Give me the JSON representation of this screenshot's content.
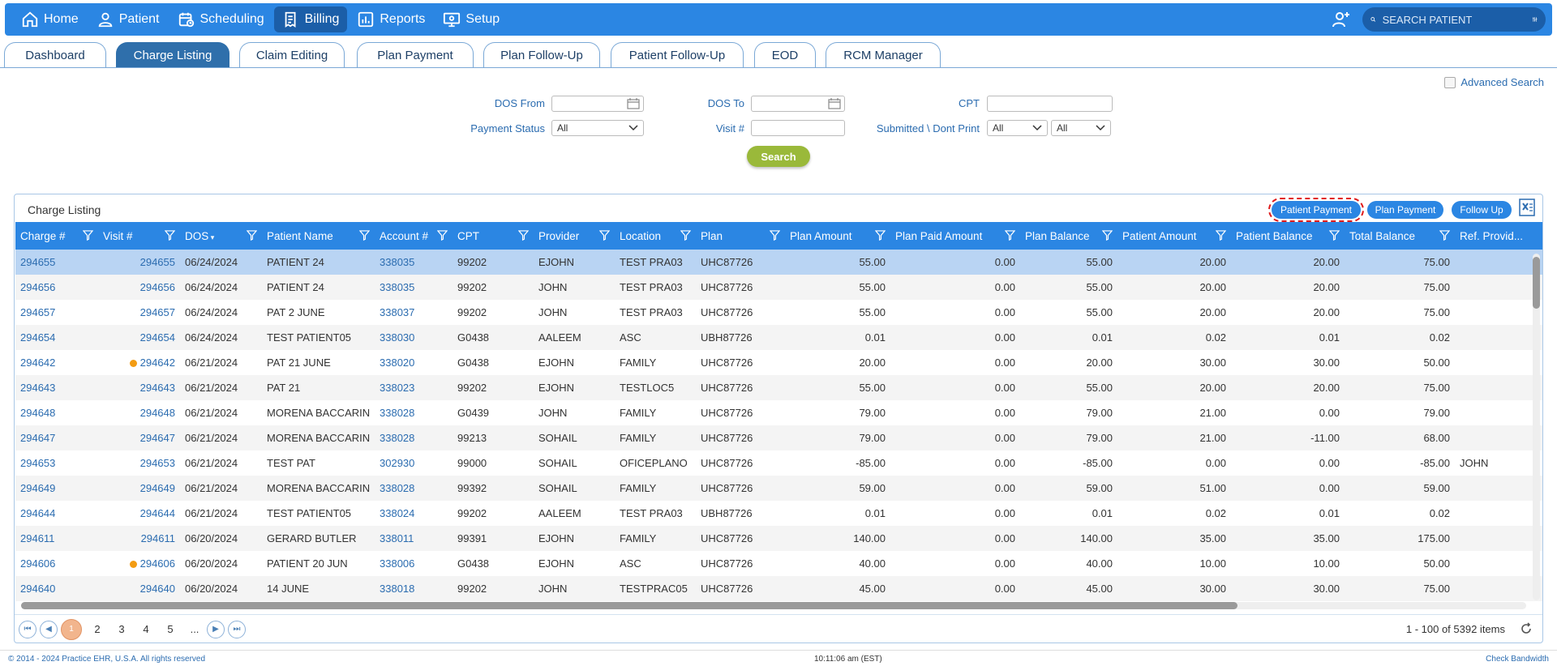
{
  "nav": {
    "items": [
      {
        "label": "Home",
        "icon": "home-icon"
      },
      {
        "label": "Patient",
        "icon": "user-icon"
      },
      {
        "label": "Scheduling",
        "icon": "calendar-clock-icon"
      },
      {
        "label": "Billing",
        "icon": "invoice-icon"
      },
      {
        "label": "Reports",
        "icon": "bar-chart-icon"
      },
      {
        "label": "Setup",
        "icon": "monitor-gear-icon"
      }
    ],
    "search_placeholder": "SEARCH PATIENT"
  },
  "tabs": [
    "Dashboard",
    "Charge Listing",
    "Claim Editing",
    "Plan Payment",
    "Plan Follow-Up",
    "Patient Follow-Up",
    "EOD",
    "RCM Manager"
  ],
  "filters": {
    "advanced_search": "Advanced Search",
    "dos_from": "DOS From",
    "dos_to": "DOS To",
    "cpt": "CPT",
    "payment_status": "Payment Status",
    "payment_status_value": "All",
    "visit": "Visit #",
    "submitted": "Submitted \\ Dont Print",
    "submitted_value1": "All",
    "submitted_value2": "All",
    "search_button": "Search"
  },
  "panel": {
    "title": "Charge Listing",
    "buttons": {
      "patient_payment": "Patient Payment",
      "plan_payment": "Plan Payment",
      "follow_up": "Follow Up"
    }
  },
  "columns": [
    "Charge #",
    "Visit #",
    "DOS",
    "Patient Name",
    "Account #",
    "CPT",
    "Provider",
    "Location",
    "Plan",
    "Plan Amount",
    "Plan Paid Amount",
    "Plan Balance",
    "Patient Amount",
    "Patient Balance",
    "Total Balance",
    "Ref. Provid..."
  ],
  "rows": [
    {
      "charge": "294655",
      "visit": "294655",
      "dot": false,
      "dos": "06/24/2024",
      "patient": "PATIENT 24",
      "account": "338035",
      "cpt": "99202",
      "provider": "EJOHN",
      "location": "TEST PRA03",
      "plan": "UHC87726",
      "plan_amount": "55.00",
      "plan_paid": "0.00",
      "plan_balance": "55.00",
      "patient_amount": "20.00",
      "patient_balance": "20.00",
      "total_balance": "75.00",
      "ref": ""
    },
    {
      "charge": "294656",
      "visit": "294656",
      "dot": false,
      "dos": "06/24/2024",
      "patient": "PATIENT 24",
      "account": "338035",
      "cpt": "99202",
      "provider": "JOHN",
      "location": "TEST PRA03",
      "plan": "UHC87726",
      "plan_amount": "55.00",
      "plan_paid": "0.00",
      "plan_balance": "55.00",
      "patient_amount": "20.00",
      "patient_balance": "20.00",
      "total_balance": "75.00",
      "ref": ""
    },
    {
      "charge": "294657",
      "visit": "294657",
      "dot": false,
      "dos": "06/24/2024",
      "patient": "PAT 2 JUNE",
      "account": "338037",
      "cpt": "99202",
      "provider": "JOHN",
      "location": "TEST PRA03",
      "plan": "UHC87726",
      "plan_amount": "55.00",
      "plan_paid": "0.00",
      "plan_balance": "55.00",
      "patient_amount": "20.00",
      "patient_balance": "20.00",
      "total_balance": "75.00",
      "ref": ""
    },
    {
      "charge": "294654",
      "visit": "294654",
      "dot": false,
      "dos": "06/24/2024",
      "patient": "TEST PATIENT05",
      "account": "338030",
      "cpt": "G0438",
      "provider": "AALEEM",
      "location": "ASC",
      "plan": "UBH87726",
      "plan_amount": "0.01",
      "plan_paid": "0.00",
      "plan_balance": "0.01",
      "patient_amount": "0.02",
      "patient_balance": "0.01",
      "total_balance": "0.02",
      "ref": ""
    },
    {
      "charge": "294642",
      "visit": "294642",
      "dot": true,
      "dos": "06/21/2024",
      "patient": "PAT 21 JUNE",
      "account": "338020",
      "cpt": "G0438",
      "provider": "EJOHN",
      "location": "FAMILY",
      "plan": "UHC87726",
      "plan_amount": "20.00",
      "plan_paid": "0.00",
      "plan_balance": "20.00",
      "patient_amount": "30.00",
      "patient_balance": "30.00",
      "total_balance": "50.00",
      "ref": ""
    },
    {
      "charge": "294643",
      "visit": "294643",
      "dot": false,
      "dos": "06/21/2024",
      "patient": "PAT 21",
      "account": "338023",
      "cpt": "99202",
      "provider": "EJOHN",
      "location": "TESTLOC5",
      "plan": "UHC87726",
      "plan_amount": "55.00",
      "plan_paid": "0.00",
      "plan_balance": "55.00",
      "patient_amount": "20.00",
      "patient_balance": "20.00",
      "total_balance": "75.00",
      "ref": ""
    },
    {
      "charge": "294648",
      "visit": "294648",
      "dot": false,
      "dos": "06/21/2024",
      "patient": "MORENA BACCARIN",
      "account": "338028",
      "cpt": "G0439",
      "provider": "JOHN",
      "location": "FAMILY",
      "plan": "UHC87726",
      "plan_amount": "79.00",
      "plan_paid": "0.00",
      "plan_balance": "79.00",
      "patient_amount": "21.00",
      "patient_balance": "0.00",
      "total_balance": "79.00",
      "ref": ""
    },
    {
      "charge": "294647",
      "visit": "294647",
      "dot": false,
      "dos": "06/21/2024",
      "patient": "MORENA BACCARIN",
      "account": "338028",
      "cpt": "99213",
      "provider": "SOHAIL",
      "location": "FAMILY",
      "plan": "UHC87726",
      "plan_amount": "79.00",
      "plan_paid": "0.00",
      "plan_balance": "79.00",
      "patient_amount": "21.00",
      "patient_balance": "-11.00",
      "total_balance": "68.00",
      "ref": ""
    },
    {
      "charge": "294653",
      "visit": "294653",
      "dot": false,
      "dos": "06/21/2024",
      "patient": "TEST PAT",
      "account": "302930",
      "cpt": "99000",
      "provider": "SOHAIL",
      "location": "OFICEPLANO",
      "plan": "UHC87726",
      "plan_amount": "-85.00",
      "plan_paid": "0.00",
      "plan_balance": "-85.00",
      "patient_amount": "0.00",
      "patient_balance": "0.00",
      "total_balance": "-85.00",
      "ref": "JOHN"
    },
    {
      "charge": "294649",
      "visit": "294649",
      "dot": false,
      "dos": "06/21/2024",
      "patient": "MORENA BACCARIN",
      "account": "338028",
      "cpt": "99392",
      "provider": "SOHAIL",
      "location": "FAMILY",
      "plan": "UHC87726",
      "plan_amount": "59.00",
      "plan_paid": "0.00",
      "plan_balance": "59.00",
      "patient_amount": "51.00",
      "patient_balance": "0.00",
      "total_balance": "59.00",
      "ref": ""
    },
    {
      "charge": "294644",
      "visit": "294644",
      "dot": false,
      "dos": "06/21/2024",
      "patient": "TEST PATIENT05",
      "account": "338024",
      "cpt": "99202",
      "provider": "AALEEM",
      "location": "TEST PRA03",
      "plan": "UBH87726",
      "plan_amount": "0.01",
      "plan_paid": "0.00",
      "plan_balance": "0.01",
      "patient_amount": "0.02",
      "patient_balance": "0.01",
      "total_balance": "0.02",
      "ref": ""
    },
    {
      "charge": "294611",
      "visit": "294611",
      "dot": false,
      "dos": "06/20/2024",
      "patient": "GERARD BUTLER",
      "account": "338011",
      "cpt": "99391",
      "provider": "EJOHN",
      "location": "FAMILY",
      "plan": "UHC87726",
      "plan_amount": "140.00",
      "plan_paid": "0.00",
      "plan_balance": "140.00",
      "patient_amount": "35.00",
      "patient_balance": "35.00",
      "total_balance": "175.00",
      "ref": ""
    },
    {
      "charge": "294606",
      "visit": "294606",
      "dot": true,
      "dos": "06/20/2024",
      "patient": "PATIENT 20 JUN",
      "account": "338006",
      "cpt": "G0438",
      "provider": "EJOHN",
      "location": "ASC",
      "plan": "UHC87726",
      "plan_amount": "40.00",
      "plan_paid": "0.00",
      "plan_balance": "40.00",
      "patient_amount": "10.00",
      "patient_balance": "10.00",
      "total_balance": "50.00",
      "ref": ""
    },
    {
      "charge": "294640",
      "visit": "294640",
      "dot": false,
      "dos": "06/20/2024",
      "patient": "14 JUNE",
      "account": "338018",
      "cpt": "99202",
      "provider": "JOHN",
      "location": "TESTPRAC05",
      "plan": "UHC87726",
      "plan_amount": "45.00",
      "plan_paid": "0.00",
      "plan_balance": "45.00",
      "patient_amount": "30.00",
      "patient_balance": "30.00",
      "total_balance": "75.00",
      "ref": ""
    }
  ],
  "pager": {
    "current": "1",
    "pages": [
      "2",
      "3",
      "4",
      "5",
      "..."
    ],
    "info": "1 - 100 of 5392 items"
  },
  "footer": {
    "copyright": "© 2014 - 2024 Practice EHR, U.S.A. All rights reserved",
    "time": "10:11:06 am (EST)",
    "bandwidth": "Check Bandwidth"
  }
}
